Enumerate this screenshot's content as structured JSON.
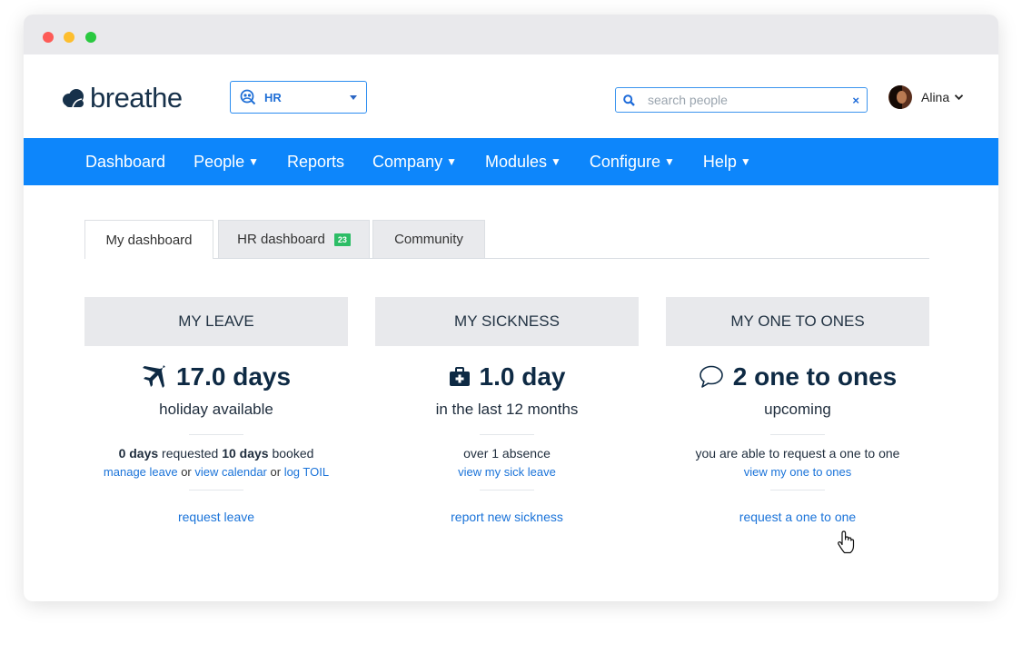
{
  "app": {
    "logo_text": "breathe"
  },
  "team_select": {
    "value": "HR"
  },
  "search": {
    "placeholder": "search people",
    "clear_label": "×"
  },
  "user": {
    "name": "Alina",
    "chevron": "⌄"
  },
  "nav": {
    "items": [
      {
        "label": "Dashboard",
        "arrow": ""
      },
      {
        "label": "People",
        "arrow": "▼"
      },
      {
        "label": "Reports",
        "arrow": ""
      },
      {
        "label": "Company",
        "arrow": "▼"
      },
      {
        "label": "Modules",
        "arrow": "▼"
      },
      {
        "label": "Configure",
        "arrow": "▼"
      },
      {
        "label": "Help",
        "arrow": "▼"
      }
    ]
  },
  "tabs": [
    {
      "label": "My dashboard",
      "active": true
    },
    {
      "label": "HR dashboard",
      "badge": "23"
    },
    {
      "label": "Community"
    }
  ],
  "cards": {
    "leave": {
      "title": "MY LEAVE",
      "icon": "plane-icon",
      "big_value": "17.0 days",
      "subtitle": "holiday available",
      "requested_value": "0 days",
      "requested_text": " requested ",
      "booked_value": "10 days",
      "booked_text": " booked",
      "link_manage": "manage leave",
      "or1": " or ",
      "link_calendar": "view calendar",
      "or2": " or ",
      "link_toil": "log TOIL",
      "action": "request leave"
    },
    "sickness": {
      "title": "MY SICKNESS",
      "icon": "medical-kit-icon",
      "big_value": "1.0 day",
      "subtitle": "in the last 12 months",
      "detail": "over 1 absence",
      "link_view": "view my sick leave",
      "action": "report new sickness"
    },
    "one_to_ones": {
      "title": "MY ONE TO ONES",
      "icon": "speech-bubble-icon",
      "big_value": "2 one to ones",
      "subtitle": "upcoming",
      "detail": "you are able to request a one to one",
      "link_view": "view my one to ones",
      "action": "request a one to one"
    }
  },
  "colors": {
    "accent": "#0d86fb",
    "link": "#1a73d9",
    "heading": "#0e2a44",
    "badge": "#2dbd66"
  }
}
